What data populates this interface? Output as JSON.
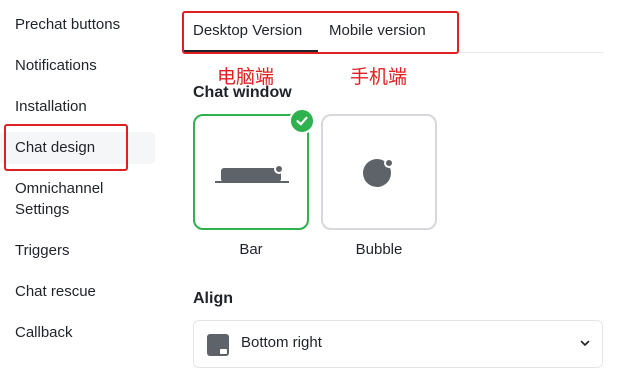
{
  "sidebar": {
    "items": [
      {
        "label": "Prechat buttons"
      },
      {
        "label": "Notifications"
      },
      {
        "label": "Installation"
      },
      {
        "label": "Chat design"
      },
      {
        "label": "Omnichannel\nSettings"
      },
      {
        "label": "Triggers"
      },
      {
        "label": "Chat rescue"
      },
      {
        "label": "Callback"
      }
    ],
    "active": "Chat design"
  },
  "tabs": [
    {
      "label": "Desktop Version"
    },
    {
      "label": "Mobile version"
    }
  ],
  "annotations": {
    "desktop_cn": "电脑端",
    "mobile_cn": "手机端"
  },
  "chat_window": {
    "title": "Chat window",
    "options": [
      {
        "label": "Bar",
        "selected": true,
        "icon": "bar-widget-icon"
      },
      {
        "label": "Bubble",
        "selected": false,
        "icon": "bubble-widget-icon"
      }
    ]
  },
  "align": {
    "title": "Align",
    "value": "Bottom right",
    "icon": "bottom-right-position-icon"
  },
  "colors": {
    "selected_border": "#2fb14f",
    "annotation_red": "#e02020",
    "icon_gray": "#5e6269"
  }
}
